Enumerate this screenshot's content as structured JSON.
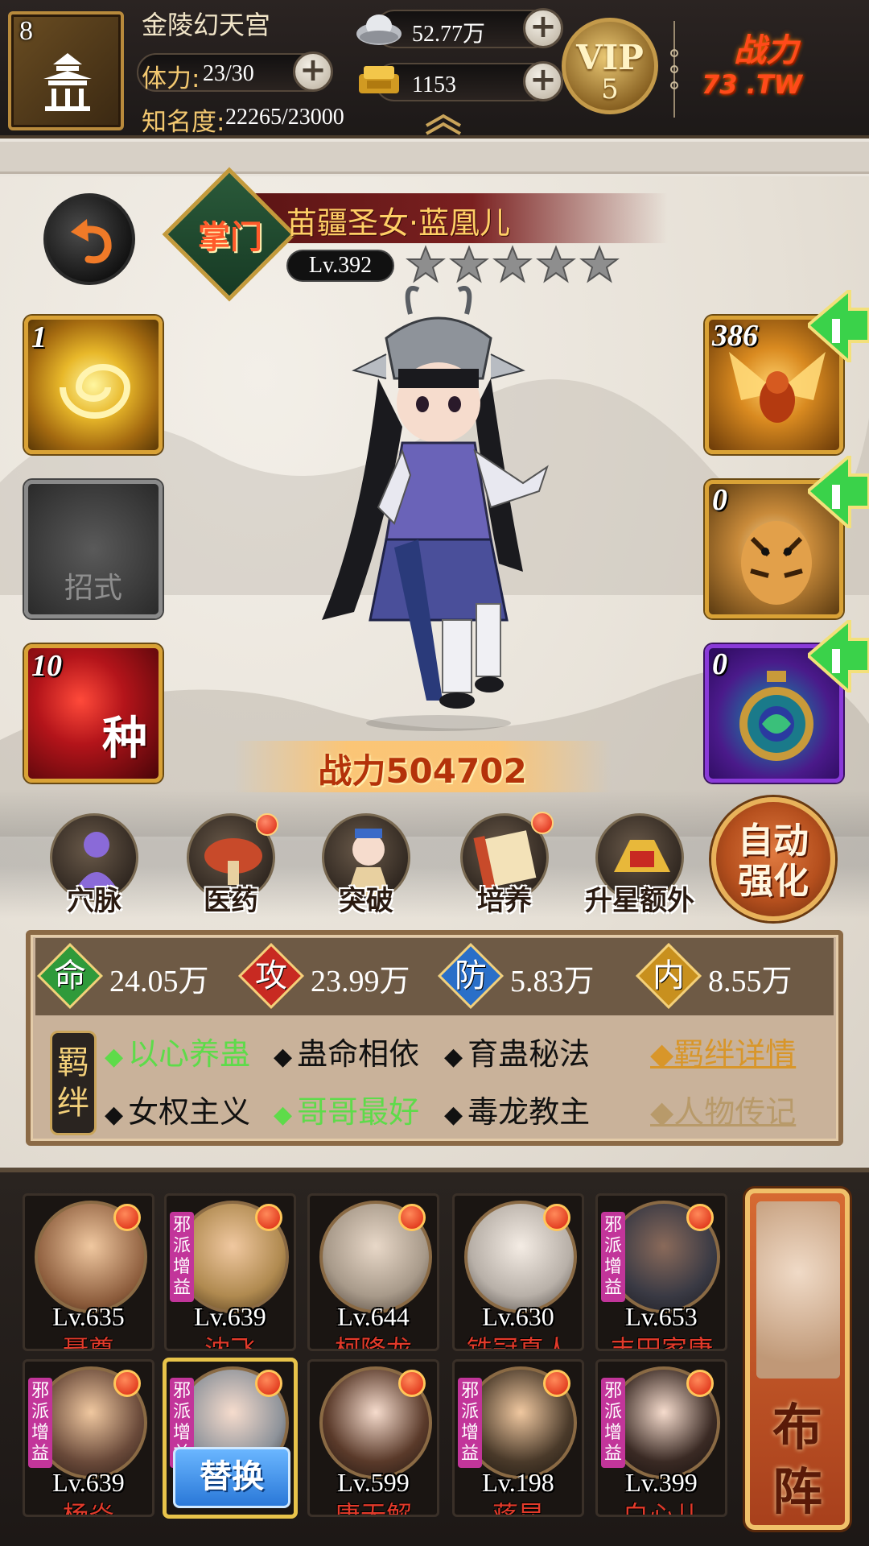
{
  "topbar": {
    "player_level": "8",
    "city_name": "金陵幻天宫",
    "stamina_label": "体力:",
    "stamina_value": "23/30",
    "fame_label": "知名度:",
    "fame_value": "22265/23000",
    "silver_value": "52.77万",
    "gold_value": "1153",
    "vip_label": "VIP",
    "vip_level": "5",
    "logo_line1": "战力",
    "logo_line2": "73 .TW"
  },
  "hero": {
    "sect_label": "掌门",
    "name": "苗疆圣女·蓝凰儿",
    "level": "Lv.392",
    "stars": 5,
    "power_label": "战力",
    "power_value": "504702"
  },
  "skills": [
    {
      "count": "1",
      "label": ""
    },
    {
      "count": "",
      "label": "招式"
    },
    {
      "count": "10",
      "label": "种"
    }
  ],
  "equipment": [
    {
      "count": "386"
    },
    {
      "count": "0"
    },
    {
      "count": "0"
    }
  ],
  "functions": [
    {
      "label": "穴脉",
      "icon": "meridian-icon",
      "badge": false
    },
    {
      "label": "医药",
      "icon": "medicine-icon",
      "badge": true
    },
    {
      "label": "突破",
      "icon": "breakthrough-icon",
      "badge": false
    },
    {
      "label": "培养",
      "icon": "scroll-icon",
      "badge": true
    },
    {
      "label": "升星额外",
      "icon": "star-upgrade-icon",
      "badge": false
    }
  ],
  "auto_strengthen": {
    "line1": "自动",
    "line2": "强化"
  },
  "stats": [
    {
      "key": "命",
      "value": "24.05万",
      "color": "#2f9a3a"
    },
    {
      "key": "攻",
      "value": "23.99万",
      "color": "#c82a22"
    },
    {
      "key": "防",
      "value": "5.83万",
      "color": "#2a6fc8"
    },
    {
      "key": "内",
      "value": "8.55万",
      "color": "#c8901e"
    }
  ],
  "bonds": {
    "tag": "羁绊",
    "items": [
      {
        "label": "以心养蛊",
        "active": true
      },
      {
        "label": "蛊命相依",
        "active": false
      },
      {
        "label": "育蛊秘法",
        "active": false
      },
      {
        "label": "女权主义",
        "active": false
      },
      {
        "label": "哥哥最好",
        "active": true
      },
      {
        "label": "毒龙教主",
        "active": false
      }
    ],
    "detail_link": "◆羁绊详情",
    "bio_link": "◆人物传记"
  },
  "roster": {
    "evil_tag": "邪派增益",
    "swap_label": "替换",
    "heroes": [
      {
        "level": "Lv.635",
        "name": "聂尊",
        "evil": false
      },
      {
        "level": "Lv.639",
        "name": "沈飞",
        "evil": true
      },
      {
        "level": "Lv.644",
        "name": "柯降龙",
        "evil": false
      },
      {
        "level": "Lv.630",
        "name": "铁冠真人",
        "evil": false
      },
      {
        "level": "Lv.653",
        "name": "丰田家康",
        "evil": true
      },
      {
        "level": "Lv.639",
        "name": "杨焱",
        "evil": true
      },
      {
        "level": "",
        "name": "",
        "evil": true,
        "selected": true
      },
      {
        "level": "Lv.599",
        "name": "唐无解",
        "evil": false
      },
      {
        "level": "Lv.198",
        "name": "蒋昆",
        "evil": true
      },
      {
        "level": "Lv.399",
        "name": "白心儿",
        "evil": true
      }
    ]
  },
  "formation": {
    "line1": "布",
    "line2": "阵"
  }
}
